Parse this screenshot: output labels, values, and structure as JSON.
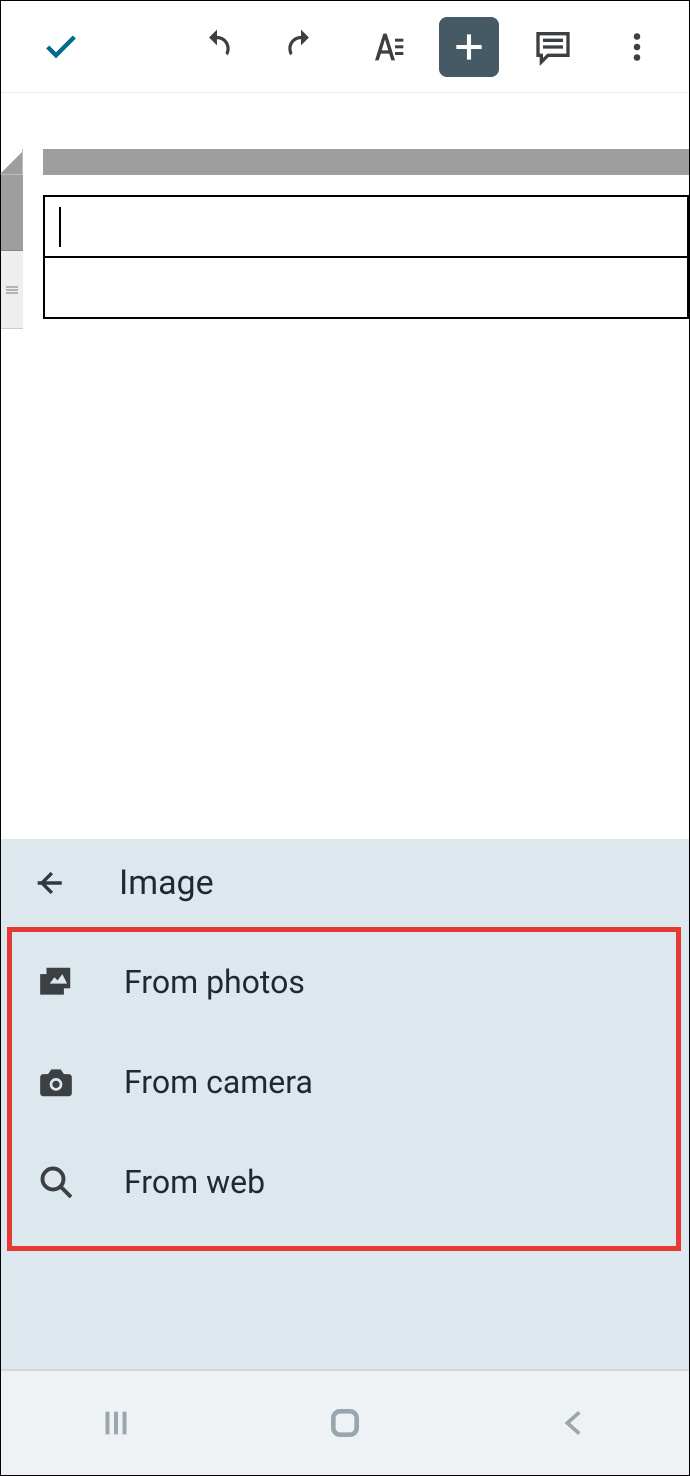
{
  "toolbar": {
    "done_icon": "check",
    "undo_icon": "undo",
    "redo_icon": "redo",
    "format_icon": "text-format",
    "insert_icon": "plus",
    "comment_icon": "comment",
    "more_icon": "more-vert"
  },
  "sheet": {
    "active_cell_value": "",
    "cursor_visible": true
  },
  "insert_panel": {
    "back_icon": "arrow-left",
    "title": "Image",
    "items": [
      {
        "icon": "photos",
        "label": "From photos"
      },
      {
        "icon": "camera",
        "label": "From camera"
      },
      {
        "icon": "search",
        "label": "From web"
      }
    ]
  },
  "highlight": {
    "color": "#e53935",
    "target": "insert_panel.items"
  },
  "navbar": {
    "recents_icon": "recents",
    "home_icon": "home",
    "back_icon": "back"
  }
}
